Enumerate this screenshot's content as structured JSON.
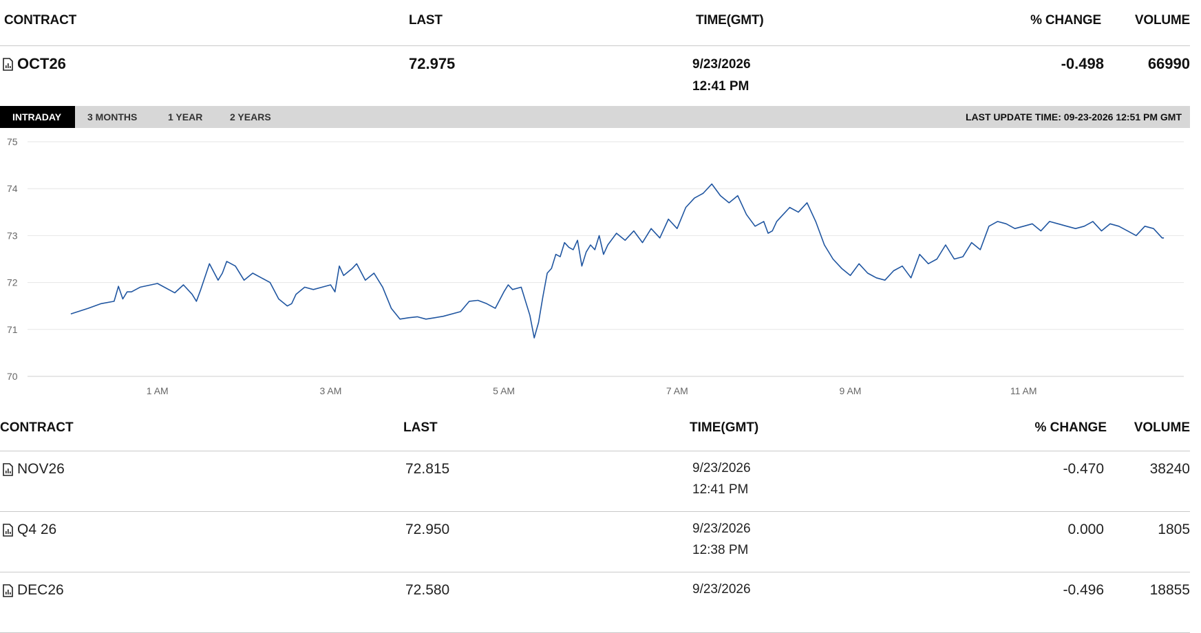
{
  "header": {
    "contract": "CONTRACT",
    "last": "LAST",
    "time": "TIME(GMT)",
    "change": "% CHANGE",
    "volume": "VOLUME"
  },
  "main": {
    "contract": "OCT26",
    "last": "72.975",
    "date": "9/23/2026",
    "time": "12:41 PM",
    "change": "-0.498",
    "volume": "66990",
    "icon": "chart-document-icon"
  },
  "tabs": [
    {
      "label": "INTRADAY",
      "active": true
    },
    {
      "label": "3 MONTHS",
      "active": false
    },
    {
      "label": "1 YEAR",
      "active": false
    },
    {
      "label": "2 YEARS",
      "active": false
    }
  ],
  "last_update": "LAST UPDATE TIME: 09-23-2026 12:51 PM GMT",
  "chart_data": {
    "type": "line",
    "series": [
      {
        "color": "#1f55a0",
        "x": [
          0.0,
          0.2,
          0.35,
          0.5,
          0.55,
          0.6,
          0.65,
          0.7,
          0.8,
          1.0,
          1.2,
          1.3,
          1.4,
          1.45,
          1.5,
          1.6,
          1.7,
          1.75,
          1.8,
          1.9,
          2.0,
          2.1,
          2.2,
          2.3,
          2.4,
          2.5,
          2.55,
          2.6,
          2.7,
          2.8,
          2.9,
          3.0,
          3.05,
          3.1,
          3.15,
          3.25,
          3.3,
          3.4,
          3.5,
          3.6,
          3.7,
          3.8,
          3.9,
          4.0,
          4.1,
          4.2,
          4.3,
          4.5,
          4.6,
          4.7,
          4.8,
          4.9,
          5.0,
          5.05,
          5.1,
          5.2,
          5.3,
          5.35,
          5.4,
          5.45,
          5.5,
          5.55,
          5.6,
          5.65,
          5.7,
          5.75,
          5.8,
          5.85,
          5.9,
          5.95,
          6.0,
          6.05,
          6.1,
          6.15,
          6.2,
          6.3,
          6.4,
          6.5,
          6.6,
          6.7,
          6.8,
          6.9,
          7.0,
          7.1,
          7.2,
          7.3,
          7.4,
          7.5,
          7.6,
          7.7,
          7.8,
          7.9,
          8.0,
          8.05,
          8.1,
          8.15,
          8.2,
          8.3,
          8.4,
          8.5,
          8.6,
          8.7,
          8.8,
          8.9,
          9.0,
          9.1,
          9.2,
          9.3,
          9.4,
          9.5,
          9.6,
          9.7,
          9.8,
          9.9,
          10.0,
          10.1,
          10.2,
          10.3,
          10.4,
          10.5,
          10.6,
          10.7,
          10.8,
          10.9,
          11.0,
          11.1,
          11.2,
          11.3,
          11.4,
          11.5,
          11.6,
          11.7,
          11.8,
          11.9,
          12.0,
          12.1,
          12.2,
          12.3,
          12.4,
          12.5,
          12.6,
          12.62
        ],
        "y": [
          71.33,
          71.45,
          71.55,
          71.6,
          71.92,
          71.65,
          71.8,
          71.8,
          71.9,
          71.98,
          71.78,
          71.95,
          71.75,
          71.6,
          71.85,
          72.4,
          72.05,
          72.2,
          72.45,
          72.35,
          72.05,
          72.2,
          72.1,
          72.0,
          71.65,
          71.5,
          71.55,
          71.75,
          71.9,
          71.85,
          71.9,
          71.95,
          71.8,
          72.35,
          72.15,
          72.3,
          72.4,
          72.05,
          72.2,
          71.9,
          71.45,
          71.22,
          71.25,
          71.27,
          71.22,
          71.25,
          71.28,
          71.38,
          71.6,
          71.62,
          71.55,
          71.45,
          71.8,
          71.95,
          71.85,
          71.9,
          71.3,
          70.82,
          71.15,
          71.7,
          72.2,
          72.3,
          72.6,
          72.55,
          72.85,
          72.75,
          72.7,
          72.9,
          72.35,
          72.65,
          72.8,
          72.7,
          73.0,
          72.6,
          72.8,
          73.05,
          72.9,
          73.1,
          72.85,
          73.15,
          72.95,
          73.35,
          73.15,
          73.6,
          73.8,
          73.9,
          74.1,
          73.85,
          73.7,
          73.85,
          73.45,
          73.2,
          73.3,
          73.05,
          73.1,
          73.3,
          73.4,
          73.6,
          73.5,
          73.7,
          73.3,
          72.8,
          72.5,
          72.3,
          72.15,
          72.4,
          72.2,
          72.1,
          72.05,
          72.25,
          72.35,
          72.1,
          72.6,
          72.4,
          72.5,
          72.8,
          72.5,
          72.55,
          72.85,
          72.7,
          73.2,
          73.3,
          73.25,
          73.15,
          73.2,
          73.25,
          73.1,
          73.3,
          73.25,
          73.2,
          73.15,
          73.2,
          73.3,
          73.1,
          73.25,
          73.2,
          73.1,
          73.0,
          73.2,
          73.15,
          72.95,
          72.95
        ]
      }
    ],
    "x_ticks": [
      "1 AM",
      "3 AM",
      "5 AM",
      "7 AM",
      "9 AM",
      "11 AM"
    ],
    "y_ticks": [
      "75",
      "74",
      "73",
      "72",
      "71",
      "70"
    ],
    "ylim": [
      70,
      75
    ],
    "grid": true
  },
  "table": {
    "header": {
      "contract": "CONTRACT",
      "last": "LAST",
      "time": "TIME(GMT)",
      "change": "% CHANGE",
      "volume": "VOLUME"
    },
    "rows": [
      {
        "contract": "NOV26",
        "last": "72.815",
        "date": "9/23/2026",
        "time": "12:41 PM",
        "change": "-0.470",
        "volume": "38240"
      },
      {
        "contract": "Q4 26",
        "last": "72.950",
        "date": "9/23/2026",
        "time": "12:38 PM",
        "change": "0.000",
        "volume": "1805"
      },
      {
        "contract": "DEC26",
        "last": "72.580",
        "date": "9/23/2026",
        "time": "",
        "change": "-0.496",
        "volume": "18855"
      }
    ]
  }
}
